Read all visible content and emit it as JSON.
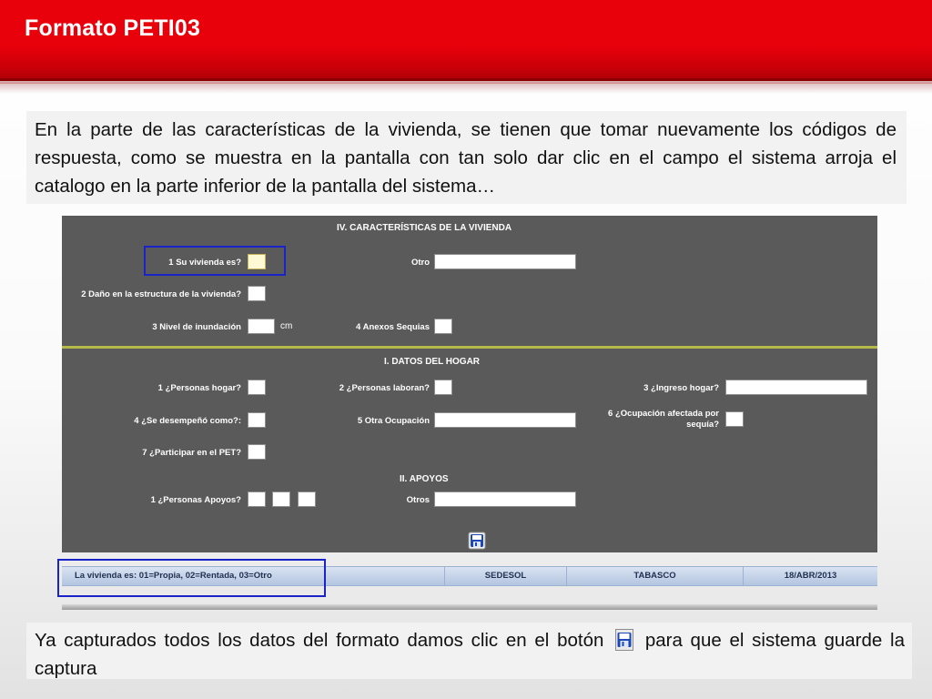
{
  "slide": {
    "title": "Formato PETI03",
    "intro_text": "En la parte de las características de la vivienda, se tienen que tomar nuevamente los códigos de respuesta, como se muestra en la pantalla con tan solo dar clic en el campo el sistema arroja el catalogo en la parte inferior de la pantalla del sistema…",
    "outro_before_icon": "Ya capturados todos los datos del formato damos clic en el botón",
    "outro_after_icon": "para que el sistema guarde la captura",
    "inline_icon": "save-icon"
  },
  "form": {
    "section_vivienda": "IV. CARACTERÍSTICAS DE LA VIVIENDA",
    "su_vivienda_label": "1 Su vivienda es?",
    "su_vivienda_value": "",
    "otro_label": "Otro",
    "otro_value": "",
    "dano_label": "2 Daño en la estructura de la vivienda?",
    "dano_value": "",
    "nivel_label": "3 Nivel de inundación",
    "nivel_value": "",
    "nivel_unit": "cm",
    "anexos_label": "4 Anexos Sequias",
    "anexos_value": "",
    "section_hogar": "I. DATOS DEL HOGAR",
    "personas_hogar_label": "1 ¿Personas hogar?",
    "personas_laboran_label": "2 ¿Personas laboran?",
    "ingreso_label": "3 ¿Ingreso hogar?",
    "desempeno_label": "4 ¿Se desempeñó como?:",
    "otra_ocupacion_label": "5 Otra Ocupación",
    "ocupacion_afectada_label": "6 ¿Ocupación afectada por sequía?",
    "participar_label": "7 ¿Participar en el PET?",
    "section_apoyos": "II. APOYOS",
    "personas_apoyos_label": "1 ¿Personas Apoyos?",
    "otros_label": "Otros",
    "save_icon": "floppy-disk-icon"
  },
  "statusbar": {
    "catalog": "La vivienda es: 01=Propia, 02=Rentada, 03=Otro",
    "org": "SEDESOL",
    "state": "TABASCO",
    "date": "18/ABR/2013"
  },
  "colors": {
    "banner_red": "#e8000b",
    "highlight_blue": "#1a22c9",
    "panel_gray": "#5a5a5a",
    "statusbar_blue": "#c6d4ea"
  }
}
